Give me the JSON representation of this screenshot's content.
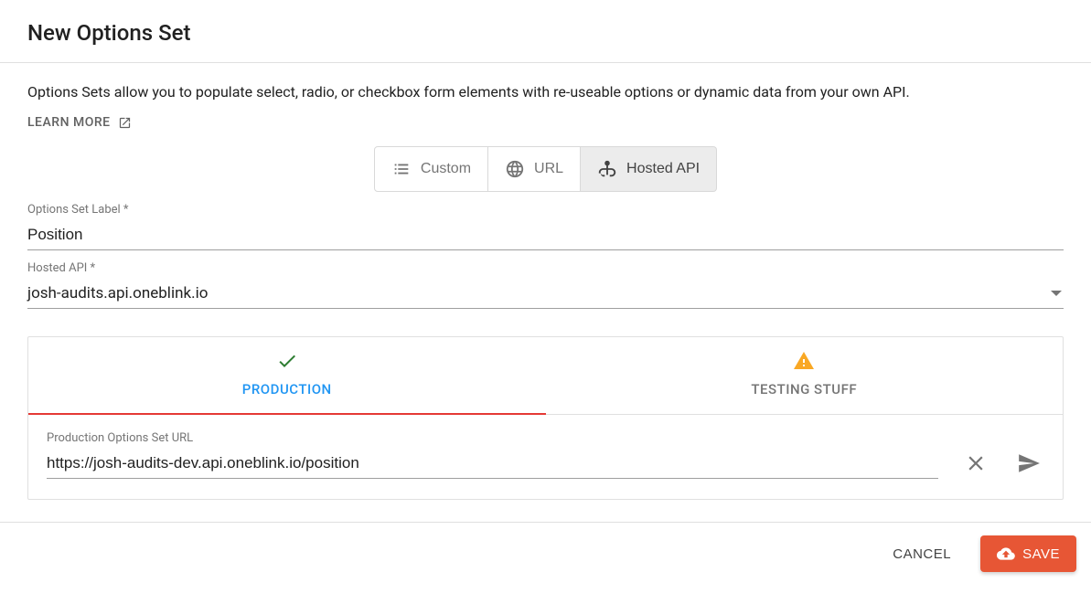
{
  "header": {
    "title": "New Options Set"
  },
  "description": "Options Sets allow you to populate select, radio, or checkbox form elements with re-useable options or dynamic data from your own API.",
  "learn_more": "LEARN MORE",
  "type_toggle": {
    "custom": "Custom",
    "url": "URL",
    "hosted_api": "Hosted API",
    "active": "hosted_api"
  },
  "fields": {
    "label": {
      "caption": "Options Set Label *",
      "value": "Position"
    },
    "hosted_api": {
      "caption": "Hosted API *",
      "value": "josh-audits.api.oneblink.io"
    }
  },
  "environments": {
    "tabs": [
      {
        "id": "prod",
        "label": "PRODUCTION",
        "status": "ok",
        "active": true
      },
      {
        "id": "test",
        "label": "TESTING STUFF",
        "status": "warn",
        "active": false
      }
    ],
    "url_field": {
      "caption": "Production Options Set URL",
      "value": "https://josh-audits-dev.api.oneblink.io/position"
    }
  },
  "footer": {
    "cancel": "CANCEL",
    "save": "SAVE"
  }
}
